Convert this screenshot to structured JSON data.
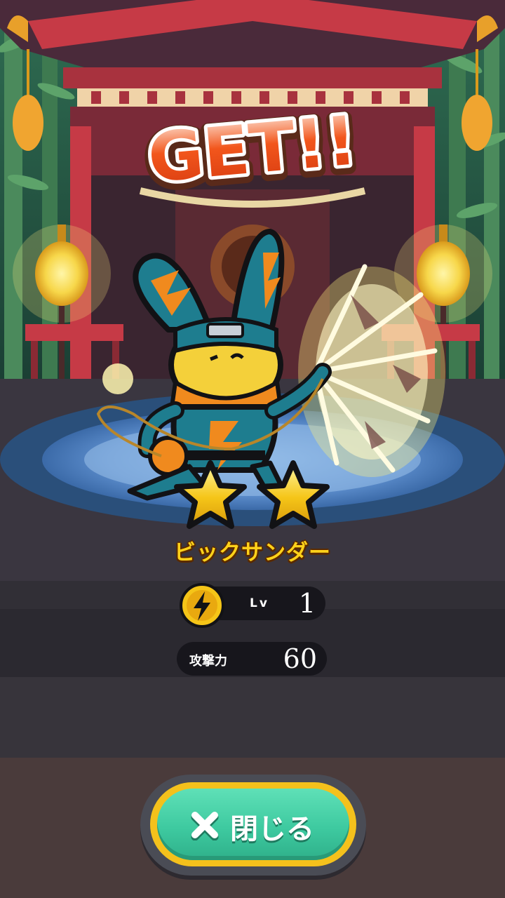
{
  "screen": "character-get-result",
  "title": {
    "text": "GET!!"
  },
  "character": {
    "name": "ビックサンダー",
    "stars": 2,
    "element_icon": "lightning-bolt-icon",
    "level_label": "Lv",
    "level_value": "1",
    "attack_label": "攻撃力",
    "attack_value": "60"
  },
  "close_button": {
    "label": "閉じる",
    "icon": "close-x-icon"
  },
  "colors": {
    "title_orange": "#f2561c",
    "name_gold": "#ffd21a",
    "button_teal": "#3ecaa0",
    "button_rim": "#f4c11c",
    "stat_pill": "#17161c",
    "character_teal": "#1e7d8f",
    "character_orange": "#f08a1e"
  }
}
